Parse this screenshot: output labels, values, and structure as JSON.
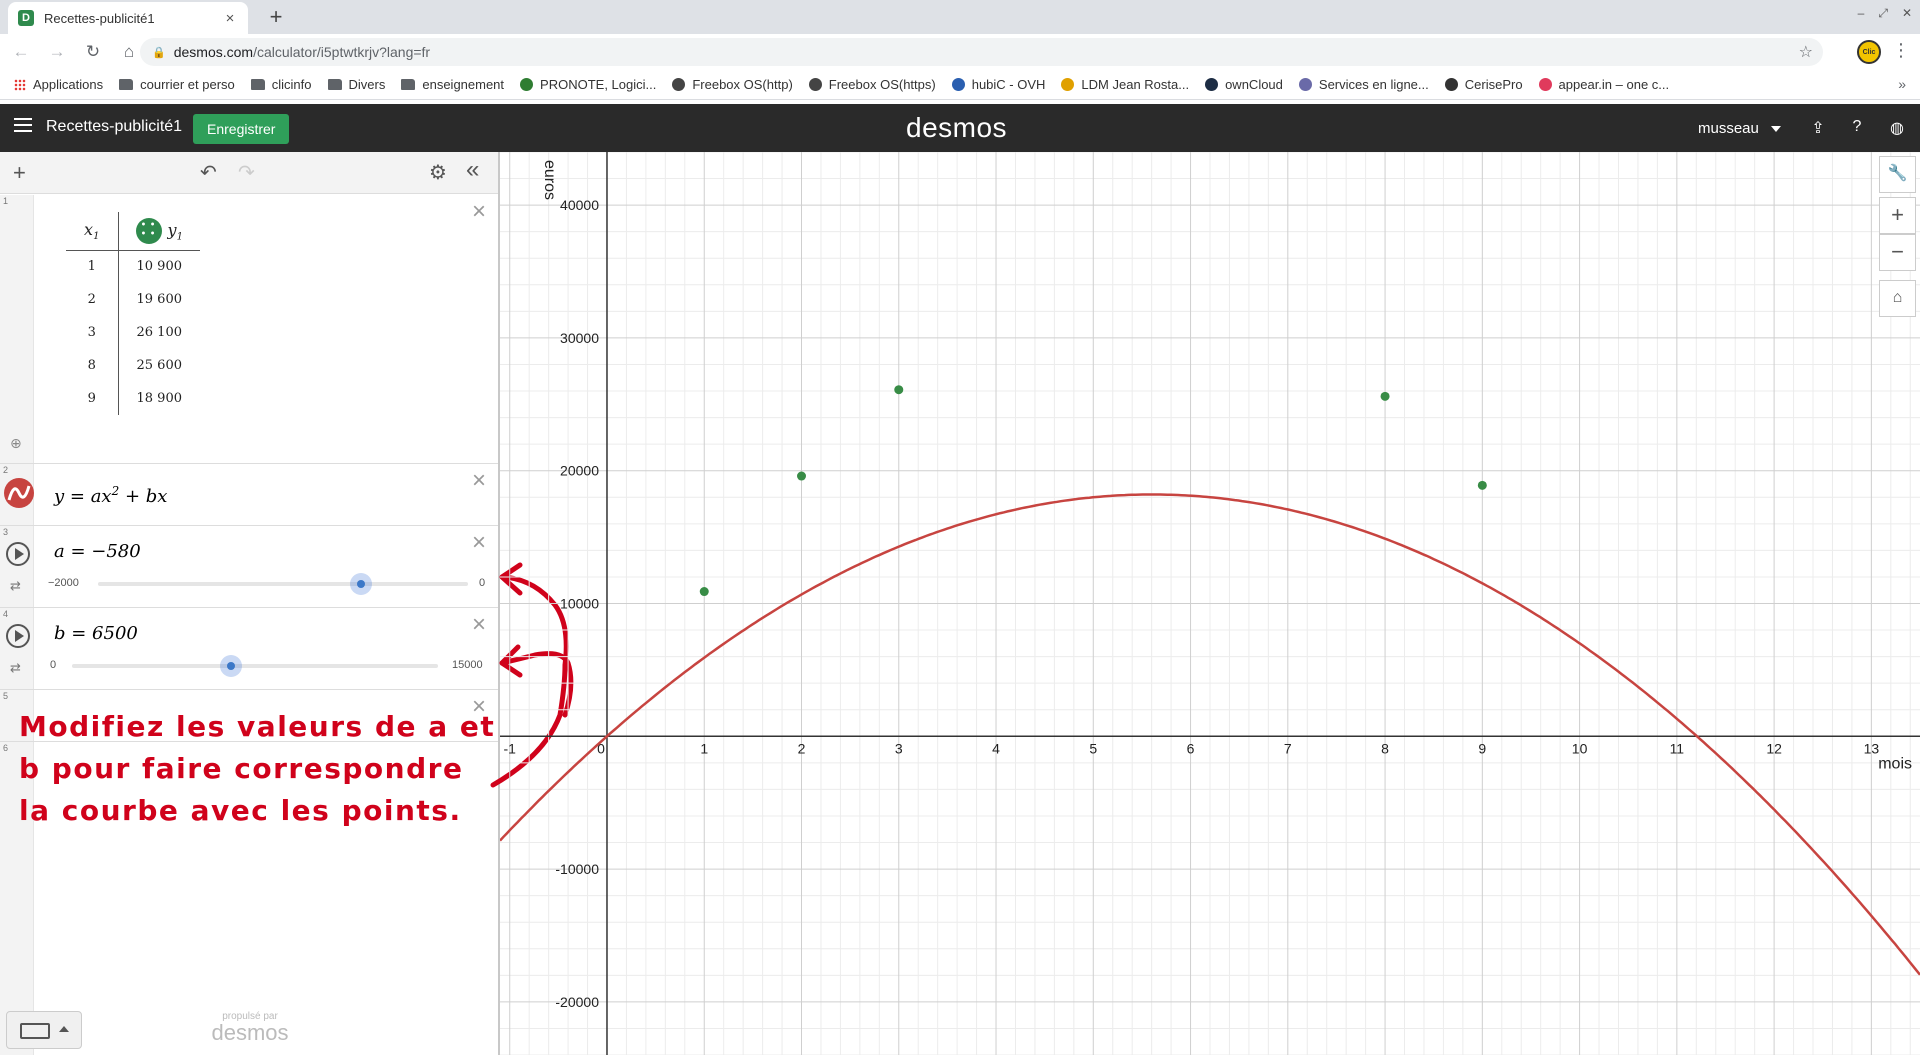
{
  "browser": {
    "tab_title": "Recettes-publicité1",
    "tab_close": "×",
    "new_tab": "+",
    "url_host": "desmos.com",
    "url_path": "/calculator/i5ptwtkrjv?lang=fr",
    "extension_label": "Clic",
    "bookmarks": [
      {
        "label": "Applications",
        "icon": "apps-grid-icon"
      },
      {
        "label": "courrier et perso",
        "icon": "folder-icon"
      },
      {
        "label": "clicinfo",
        "icon": "folder-icon"
      },
      {
        "label": "Divers",
        "icon": "folder-icon"
      },
      {
        "label": "enseignement",
        "icon": "folder-icon"
      },
      {
        "label": "PRONOTE, Logici...",
        "icon": "pronote-icon"
      },
      {
        "label": "Freebox OS(http)",
        "icon": "freebox-icon"
      },
      {
        "label": "Freebox OS(https)",
        "icon": "freebox-icon"
      },
      {
        "label": "hubiC - OVH",
        "icon": "hubic-icon"
      },
      {
        "label": "LDM Jean Rosta...",
        "icon": "ldm-icon"
      },
      {
        "label": "ownCloud",
        "icon": "owncloud-icon"
      },
      {
        "label": "Services en ligne...",
        "icon": "services-icon"
      },
      {
        "label": "CerisePro",
        "icon": "cerisepro-icon"
      },
      {
        "label": "appear.in – one c...",
        "icon": "appearin-icon"
      }
    ]
  },
  "desmos": {
    "graph_title": "Recettes-publicité1",
    "save_label": "Enregistrer",
    "logo": "desmos",
    "user": "musseau",
    "powered_small": "propulsé par",
    "powered_brand": "desmos"
  },
  "expressions": {
    "numbers": [
      "1",
      "2",
      "3",
      "4",
      "5",
      "6"
    ],
    "table": {
      "headers": [
        "x",
        "y"
      ],
      "header_sub": "1",
      "rows": [
        [
          "1",
          "10 900"
        ],
        [
          "2",
          "19 600"
        ],
        [
          "3",
          "26 100"
        ],
        [
          "8",
          "25 600"
        ],
        [
          "9",
          "18 900"
        ]
      ]
    },
    "equation": {
      "lhs": "y = ax",
      "exp": "2",
      "rhs": " + bx"
    },
    "slider_a": {
      "text": "a = −580",
      "value": -580,
      "min": -2000,
      "max": 0,
      "min_label": "−2000",
      "max_label": "0"
    },
    "slider_b": {
      "text": "b = 6500",
      "value": 6500,
      "min": 0,
      "max": 15000,
      "min_label": "0",
      "max_label": "15000"
    },
    "annotation": "Modifiez les valeurs de a et b pour faire correspondre la courbe avec les points."
  },
  "chart_data": {
    "type": "scatter",
    "xlabel": "mois",
    "ylabel": "euros",
    "xlim": [
      -1.1,
      13.5
    ],
    "ylim": [
      -24000,
      44000
    ],
    "x_ticks": [
      -1,
      0,
      1,
      2,
      3,
      4,
      5,
      6,
      7,
      8,
      9,
      10,
      11,
      12,
      13
    ],
    "y_ticks": [
      -20000,
      -10000,
      10000,
      20000,
      30000,
      40000
    ],
    "grid": true,
    "points": {
      "x": [
        1,
        2,
        3,
        8,
        9
      ],
      "y": [
        10900,
        19600,
        26100,
        25600,
        18900
      ],
      "color": "#388c46"
    },
    "curve": {
      "expr": "y = -580x^2 + 6500x",
      "a": -580,
      "b": 6500,
      "color": "#c74440"
    }
  },
  "colors": {
    "accent_green": "#2f9f5a",
    "header_bg": "#2a2a2a",
    "annotation_red": "#d0021b"
  }
}
